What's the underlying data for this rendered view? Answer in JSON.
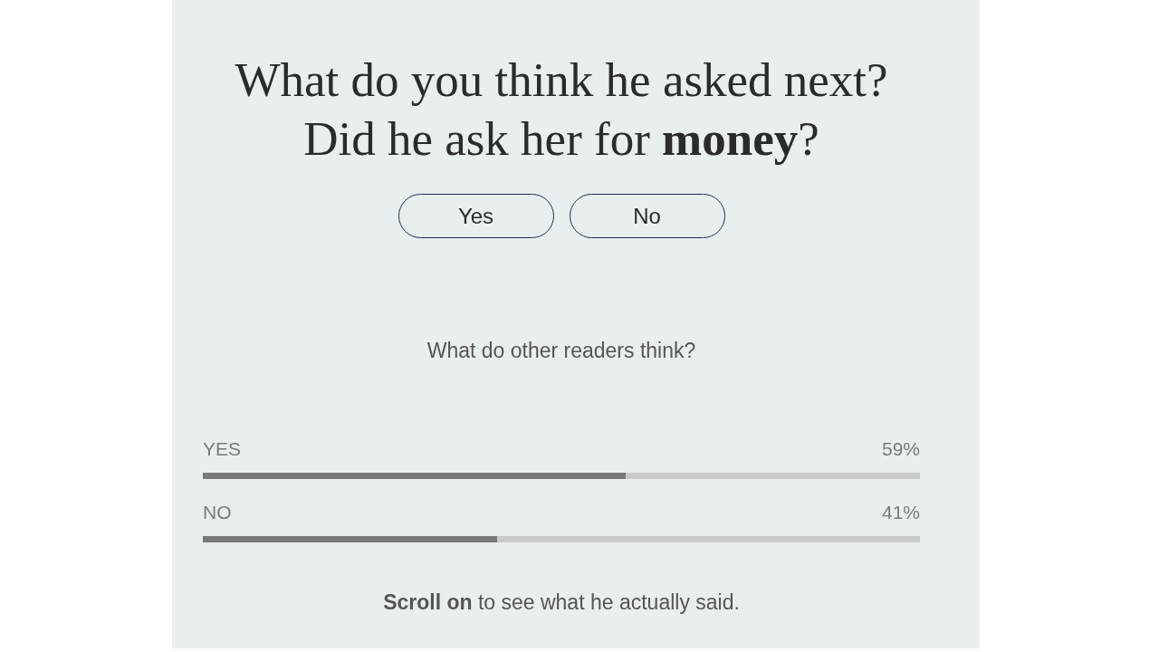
{
  "question": {
    "lines": [
      "What do you think he asked next?",
      "Did he ask her for **money**?"
    ]
  },
  "answers": [
    {
      "label": "Yes",
      "selected": false
    },
    {
      "label": "No",
      "selected": false
    }
  ],
  "results": {
    "prompt": "What do other readers think?",
    "options": [
      {
        "label": "YES",
        "reading": "59%",
        "level": 0.59
      },
      {
        "label": "NO",
        "reading": "41%",
        "level": 0.41
      }
    ]
  },
  "footer": "**Scroll on** to see what he actually said."
}
